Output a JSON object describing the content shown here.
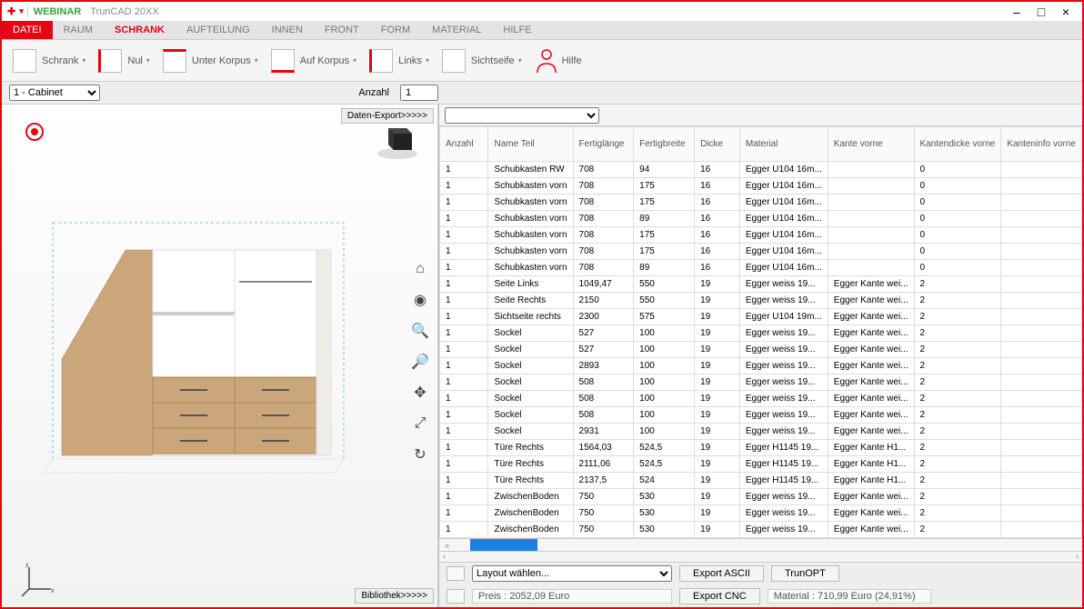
{
  "title": {
    "webinar": "WEBINAR",
    "app": "TrunCAD 20XX"
  },
  "winbtns": {
    "min": "–",
    "max": "□",
    "close": "×"
  },
  "menu": {
    "file": "DATEI",
    "items": [
      "RAUM",
      "SCHRANK",
      "AUFTEILUNG",
      "INNEN",
      "FRONT",
      "FORM",
      "MATERIAL",
      "HILFE"
    ],
    "active": "SCHRANK"
  },
  "ribbon": {
    "btn1": "Schrank",
    "btn2": "Nul",
    "btn3": "Unter Korpus",
    "btn4": "Auf Korpus",
    "btn5": "Links",
    "btn6": "Sichtseife",
    "btn7": "Hilfe"
  },
  "formbar": {
    "selector_value": "1 - Cabinet",
    "anzahl_label": "Anzahl",
    "anzahl_value": "1"
  },
  "viewport": {
    "export_btn": "Daten-Export>>>>>",
    "bibliothek_btn": "Bibliothek>>>>>"
  },
  "grid": {
    "headers": [
      "Anzahl",
      "Name Teil",
      "Fertiglänge",
      "Fertigbreite",
      "Dicke",
      "Material",
      "Kante vorne",
      "Kantendicke vorne",
      "Kanteninfo vorne"
    ],
    "rows": [
      [
        "1",
        "Schubkasten RW",
        "708",
        "94",
        "16",
        "Egger U104 16m...",
        "",
        "0",
        ""
      ],
      [
        "1",
        "Schubkasten vorn",
        "708",
        "175",
        "16",
        "Egger U104 16m...",
        "",
        "0",
        ""
      ],
      [
        "1",
        "Schubkasten vorn",
        "708",
        "175",
        "16",
        "Egger U104 16m...",
        "",
        "0",
        ""
      ],
      [
        "1",
        "Schubkasten vorn",
        "708",
        "89",
        "16",
        "Egger U104 16m...",
        "",
        "0",
        ""
      ],
      [
        "1",
        "Schubkasten vorn",
        "708",
        "175",
        "16",
        "Egger U104 16m...",
        "",
        "0",
        ""
      ],
      [
        "1",
        "Schubkasten vorn",
        "708",
        "175",
        "16",
        "Egger U104 16m...",
        "",
        "0",
        ""
      ],
      [
        "1",
        "Schubkasten vorn",
        "708",
        "89",
        "16",
        "Egger U104 16m...",
        "",
        "0",
        ""
      ],
      [
        "1",
        "Seite Links",
        "1049,47",
        "550",
        "19",
        "Egger weiss 19...",
        "Egger Kante wei...",
        "2",
        ""
      ],
      [
        "1",
        "Seite Rechts",
        "2150",
        "550",
        "19",
        "Egger weiss 19...",
        "Egger Kante wei...",
        "2",
        ""
      ],
      [
        "1",
        "Sichtseite rechts",
        "2300",
        "575",
        "19",
        "Egger U104 19m...",
        "Egger Kante wei...",
        "2",
        ""
      ],
      [
        "1",
        "Sockel",
        "527",
        "100",
        "19",
        "Egger weiss 19...",
        "Egger Kante wei...",
        "2",
        ""
      ],
      [
        "1",
        "Sockel",
        "527",
        "100",
        "19",
        "Egger weiss 19...",
        "Egger Kante wei...",
        "2",
        ""
      ],
      [
        "1",
        "Sockel",
        "2893",
        "100",
        "19",
        "Egger weiss 19...",
        "Egger Kante wei...",
        "2",
        ""
      ],
      [
        "1",
        "Sockel",
        "508",
        "100",
        "19",
        "Egger weiss 19...",
        "Egger Kante wei...",
        "2",
        ""
      ],
      [
        "1",
        "Sockel",
        "508",
        "100",
        "19",
        "Egger weiss 19...",
        "Egger Kante wei...",
        "2",
        ""
      ],
      [
        "1",
        "Sockel",
        "508",
        "100",
        "19",
        "Egger weiss 19...",
        "Egger Kante wei...",
        "2",
        ""
      ],
      [
        "1",
        "Sockel",
        "2931",
        "100",
        "19",
        "Egger weiss 19...",
        "Egger Kante wei...",
        "2",
        ""
      ],
      [
        "1",
        "Türe Rechts",
        "1564,03",
        "524,5",
        "19",
        "Egger H1145 19...",
        "Egger Kante H1...",
        "2",
        ""
      ],
      [
        "1",
        "Türe Rechts",
        "2111,06",
        "524,5",
        "19",
        "Egger H1145 19...",
        "Egger Kante H1...",
        "2",
        ""
      ],
      [
        "1",
        "Türe Rechts",
        "2137,5",
        "524",
        "19",
        "Egger H1145 19...",
        "Egger Kante H1...",
        "2",
        ""
      ],
      [
        "1",
        "ZwischenBoden",
        "750",
        "530",
        "19",
        "Egger weiss 19...",
        "Egger Kante wei...",
        "2",
        ""
      ],
      [
        "1",
        "ZwischenBoden",
        "750",
        "530",
        "19",
        "Egger weiss 19...",
        "Egger Kante wei...",
        "2",
        ""
      ],
      [
        "1",
        "ZwischenBoden",
        "750",
        "530",
        "19",
        "Egger weiss 19...",
        "Egger Kante wei...",
        "2",
        ""
      ]
    ]
  },
  "bottom": {
    "layout_placeholder": "Layout wählen...",
    "export_ascii": "Export ASCII",
    "trunopt": "TrunOPT",
    "preis_label": "Preis : 2052,09 Euro",
    "export_cnc": "Export CNC",
    "material_label": "Material : 710,99 Euro (24,91%)"
  }
}
